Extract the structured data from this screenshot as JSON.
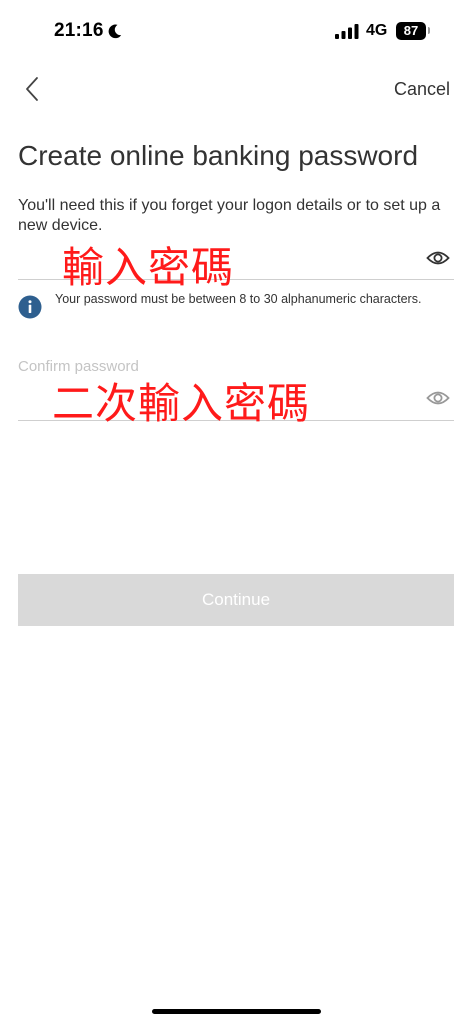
{
  "status_bar": {
    "time": "21:16",
    "network": "4G",
    "battery": "87",
    "icons": [
      "moon-icon",
      "cellular-signal-icon",
      "battery-icon"
    ]
  },
  "nav": {
    "back_icon": "chevron-left-icon",
    "cancel_label": "Cancel"
  },
  "title": "Create online banking password",
  "description": "You'll need this if you forget your logon details or to set up a new device.",
  "password_field": {
    "value": "",
    "eye_icon": "eye-icon"
  },
  "annotations": {
    "password": "輸入密碼",
    "confirm": "二次輸入密碼",
    "color": "#ff1a1a"
  },
  "info": {
    "icon": "info-icon",
    "text": "Your password must be between 8 to 30 alphanumeric characters.",
    "icon_color": "#2e5f8f"
  },
  "confirm_field": {
    "placeholder": "Confirm password",
    "eye_icon": "eye-icon"
  },
  "continue_label": "Continue",
  "colors": {
    "button_disabled": "#d9d9d9",
    "divider": "#cfcfcf",
    "text": "#333333"
  }
}
